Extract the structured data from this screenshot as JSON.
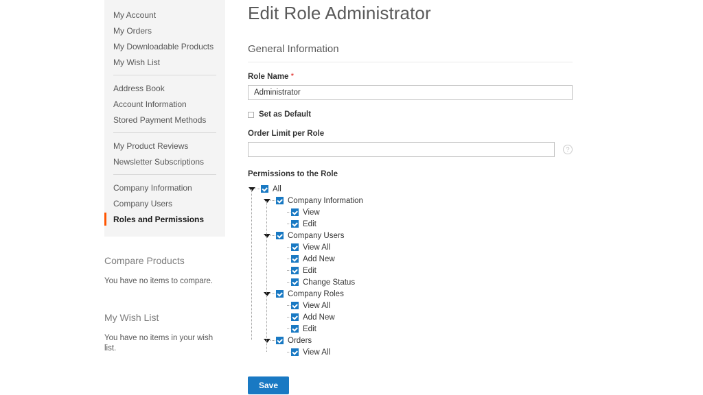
{
  "sidebar": {
    "groups": [
      {
        "items": [
          {
            "label": "My Account",
            "current": false
          },
          {
            "label": "My Orders",
            "current": false
          },
          {
            "label": "My Downloadable Products",
            "current": false
          },
          {
            "label": "My Wish List",
            "current": false
          }
        ]
      },
      {
        "items": [
          {
            "label": "Address Book",
            "current": false
          },
          {
            "label": "Account Information",
            "current": false
          },
          {
            "label": "Stored Payment Methods",
            "current": false
          }
        ]
      },
      {
        "items": [
          {
            "label": "My Product Reviews",
            "current": false
          },
          {
            "label": "Newsletter Subscriptions",
            "current": false
          }
        ]
      },
      {
        "items": [
          {
            "label": "Company Information",
            "current": false
          },
          {
            "label": "Company Users",
            "current": false
          },
          {
            "label": "Roles and Permissions",
            "current": true
          }
        ]
      }
    ],
    "compare_products": {
      "title": "Compare Products",
      "empty_text": "You have no items to compare."
    },
    "wish_list": {
      "title": "My Wish List",
      "empty_text": "You have no items in your wish list."
    },
    "accent_color": "#ff5501"
  },
  "main": {
    "page_title": "Edit Role Administrator",
    "section_legend": "General Information",
    "role_name": {
      "label": "Role Name",
      "required_marker": "*",
      "value": "Administrator",
      "placeholder": ""
    },
    "set_as_default": {
      "label": "Set as Default",
      "checked": false
    },
    "order_limit": {
      "label": "Order Limit per Role",
      "value": "",
      "placeholder": "",
      "help_icon": "question-mark-icon",
      "help_glyph": "?"
    },
    "permissions": {
      "label": "Permissions to the Role",
      "nodes": [
        {
          "label": "All",
          "depth": 0,
          "checked": true,
          "expandable": true,
          "last": false
        },
        {
          "label": "Company Information",
          "depth": 1,
          "checked": true,
          "expandable": true,
          "last": false
        },
        {
          "label": "View",
          "depth": 2,
          "checked": true,
          "expandable": false,
          "last": false
        },
        {
          "label": "Edit",
          "depth": 2,
          "checked": true,
          "expandable": false,
          "last": true
        },
        {
          "label": "Company Users",
          "depth": 1,
          "checked": true,
          "expandable": true,
          "last": false
        },
        {
          "label": "View All",
          "depth": 2,
          "checked": true,
          "expandable": false,
          "last": false
        },
        {
          "label": "Add New",
          "depth": 2,
          "checked": true,
          "expandable": false,
          "last": false
        },
        {
          "label": "Edit",
          "depth": 2,
          "checked": true,
          "expandable": false,
          "last": false
        },
        {
          "label": "Change Status",
          "depth": 2,
          "checked": true,
          "expandable": false,
          "last": true
        },
        {
          "label": "Company Roles",
          "depth": 1,
          "checked": true,
          "expandable": true,
          "last": false
        },
        {
          "label": "View All",
          "depth": 2,
          "checked": true,
          "expandable": false,
          "last": false
        },
        {
          "label": "Add New",
          "depth": 2,
          "checked": true,
          "expandable": false,
          "last": false
        },
        {
          "label": "Edit",
          "depth": 2,
          "checked": true,
          "expandable": false,
          "last": true
        },
        {
          "label": "Orders",
          "depth": 1,
          "checked": true,
          "expandable": true,
          "last": true
        },
        {
          "label": "View All",
          "depth": 2,
          "checked": true,
          "expandable": false,
          "last": true
        }
      ]
    },
    "save_button": "Save",
    "primary_color": "#1979c3"
  }
}
